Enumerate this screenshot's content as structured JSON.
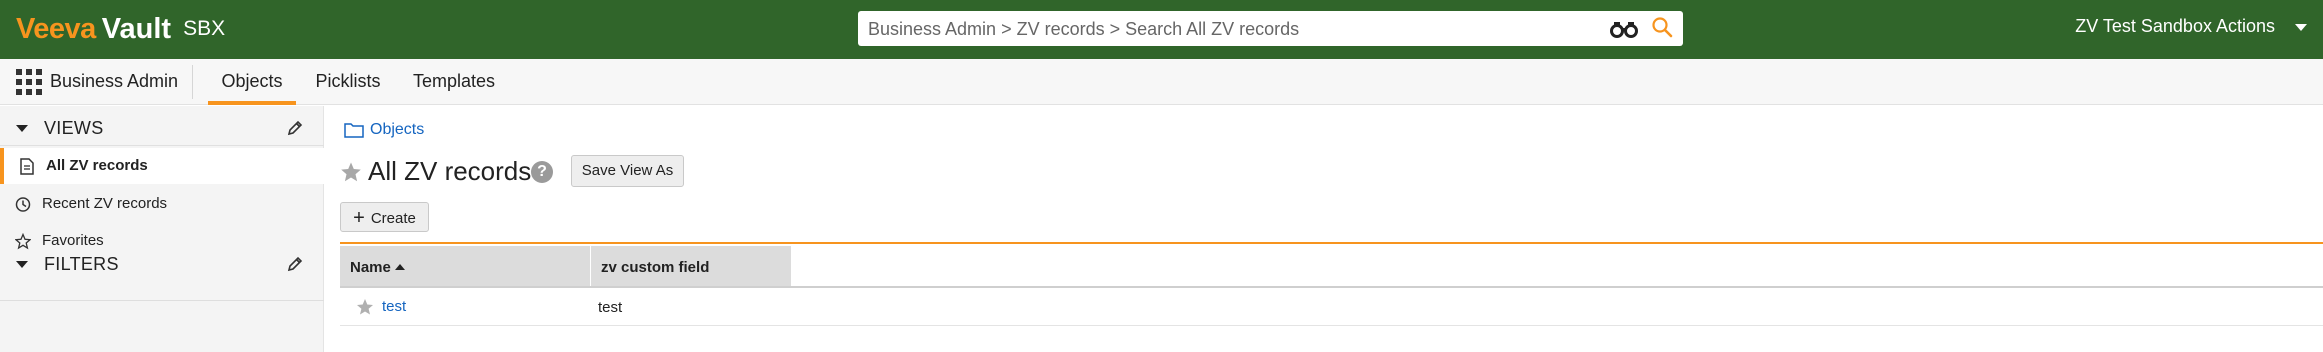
{
  "app": {
    "brand_primary": "Veeva",
    "brand_secondary": "Vault",
    "environment": "SBX",
    "search_placeholder": "Business Admin > ZV records > Search All ZV records",
    "actions_label": "ZV Test Sandbox Actions",
    "header_color": "#30652a",
    "accent_color": "#f7941e"
  },
  "nav": {
    "app_name": "Business Admin",
    "tabs": [
      {
        "label": "Objects",
        "active": true
      },
      {
        "label": "Picklists",
        "active": false
      },
      {
        "label": "Templates",
        "active": false
      }
    ]
  },
  "sidebar": {
    "views_label": "VIEWS",
    "items": [
      {
        "label": "All ZV records",
        "icon": "document-icon",
        "active": true
      },
      {
        "label": "Recent ZV records",
        "icon": "clock-icon",
        "active": false
      },
      {
        "label": "Favorites",
        "icon": "star-icon",
        "active": false
      }
    ],
    "filters_label": "FILTERS"
  },
  "main": {
    "breadcrumb": "Objects",
    "view_title": "All ZV records",
    "help_glyph": "?",
    "save_view_label": "Save View As",
    "create_label": "Create",
    "table": {
      "columns": [
        "Name",
        "zv custom field"
      ],
      "sorted_column": "Name",
      "sort_direction": "ascending",
      "rows": [
        {
          "name": "test",
          "zv_custom_field": "test"
        }
      ]
    }
  }
}
